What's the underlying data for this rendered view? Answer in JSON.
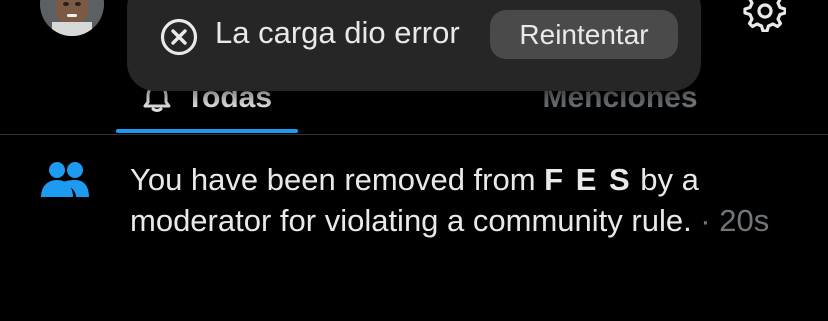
{
  "toast": {
    "message": "La carga dio error",
    "retry_label": "Reintentar"
  },
  "tabs": [
    {
      "label": "Todas",
      "selected": true
    },
    {
      "label": "Menciones",
      "selected": false
    }
  ],
  "notification": {
    "text_before": "You have been removed from ",
    "community": "F E S",
    "text_after": " by a moderator for violating a community rule.",
    "separator": " · ",
    "time": "20s"
  },
  "colors": {
    "background": "#000000",
    "text": "#e7e9ea",
    "secondary_text": "#71767b",
    "accent": "#1d9bf0",
    "toast_bg": "#262626",
    "button_bg": "#4a4a4a"
  },
  "icons": {
    "toast_icon": "close-circle-icon",
    "tab_icon": "bell-icon",
    "header_right": "gear-icon",
    "notification_icon": "people-icon"
  }
}
